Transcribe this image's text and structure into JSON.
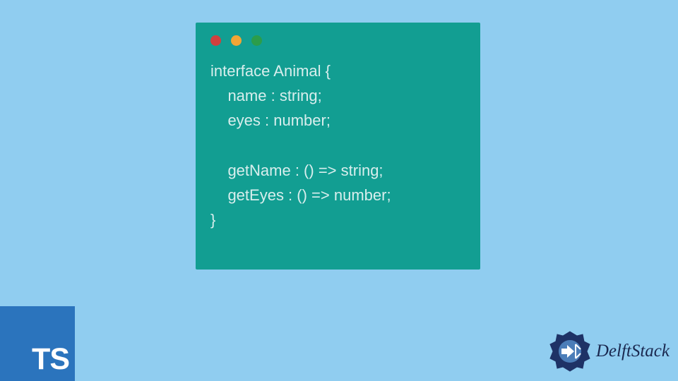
{
  "code": {
    "line1": "interface Animal {",
    "line2": "    name : string;",
    "line3": "    eyes : number;",
    "line4": "",
    "line5": "    getName : () => string;",
    "line6": "    getEyes : () => number;",
    "line7": "}"
  },
  "ts_logo": {
    "text": "TS"
  },
  "branding": {
    "text": "DelftStack"
  },
  "colors": {
    "background": "#90cdf0",
    "window": "#129e92",
    "code_text": "#d8eeed",
    "ts_bg": "#2b74bd",
    "brand_text": "#1a284f"
  }
}
